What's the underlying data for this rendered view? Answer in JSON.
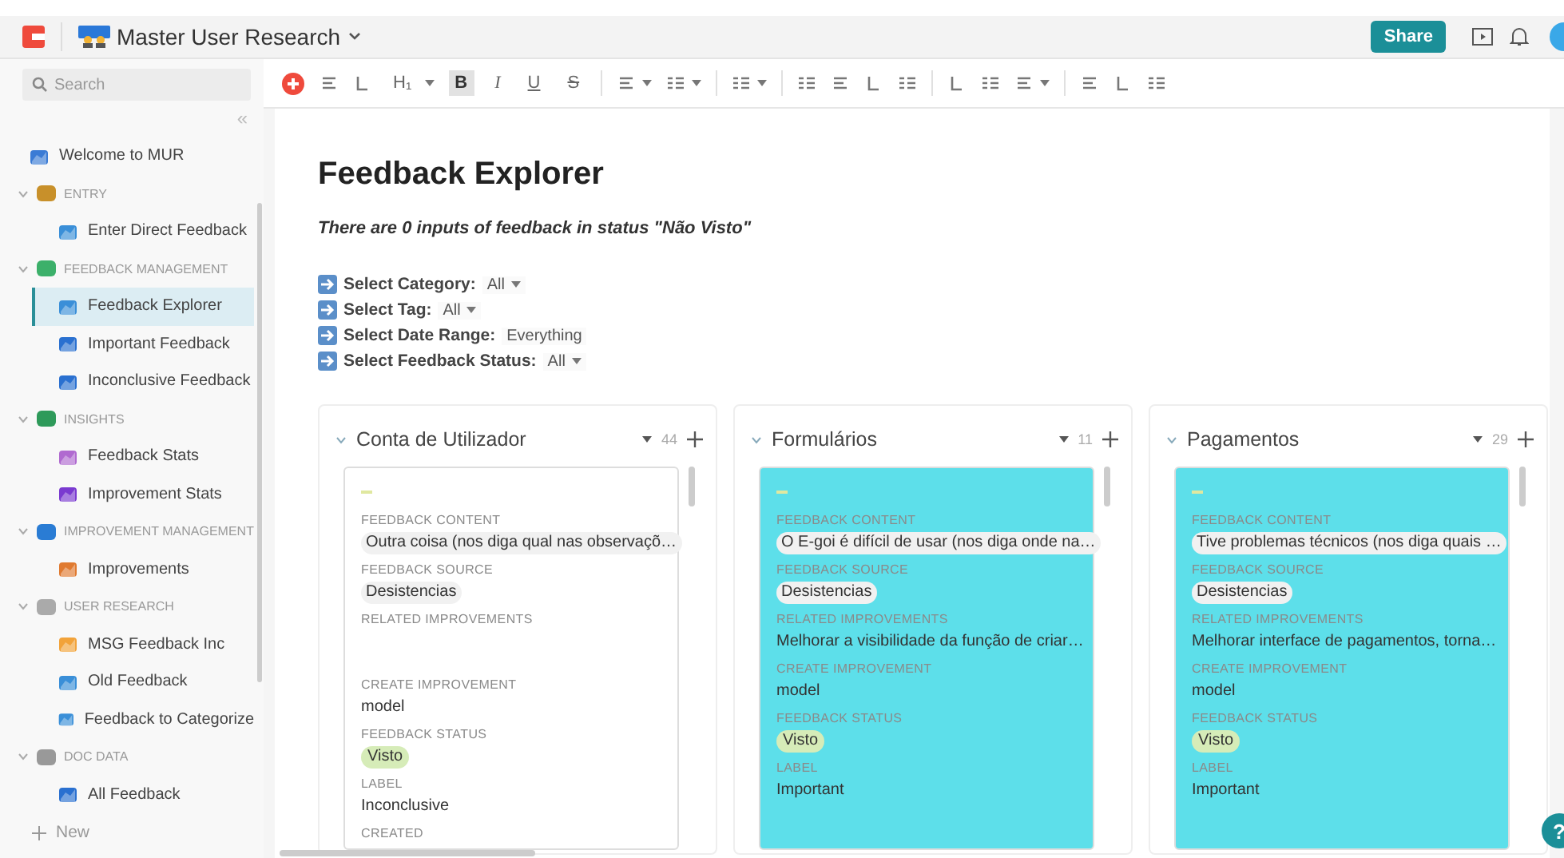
{
  "doc": {
    "title": "Master User Research",
    "share": "Share"
  },
  "search": {
    "placeholder": "Search"
  },
  "toolbar": [
    {
      "kind": "icon"
    },
    {
      "kind": "icon"
    },
    {
      "kind": "text",
      "label": "H₁",
      "selected": false
    },
    {
      "kind": "caret"
    },
    {
      "kind": "text",
      "label": "B",
      "selected": true
    },
    {
      "kind": "text",
      "label": "I",
      "selected": false
    },
    {
      "kind": "text",
      "label": "U",
      "selected": false
    },
    {
      "kind": "text",
      "label": "S",
      "selected": false
    },
    {
      "kind": "sep"
    },
    {
      "kind": "icon"
    },
    {
      "kind": "caret"
    },
    {
      "kind": "icon"
    },
    {
      "kind": "caret"
    },
    {
      "kind": "sep"
    },
    {
      "kind": "icon"
    },
    {
      "kind": "caret"
    },
    {
      "kind": "sep"
    },
    {
      "kind": "icon"
    },
    {
      "kind": "icon"
    },
    {
      "kind": "icon"
    },
    {
      "kind": "icon"
    },
    {
      "kind": "sep"
    },
    {
      "kind": "icon"
    },
    {
      "kind": "icon"
    },
    {
      "kind": "icon"
    },
    {
      "kind": "caret"
    },
    {
      "kind": "sep"
    },
    {
      "kind": "icon"
    },
    {
      "kind": "icon"
    },
    {
      "kind": "icon"
    }
  ],
  "sidebar": {
    "collapse": "«",
    "new": "New",
    "items": [
      {
        "kind": "page",
        "label": "Welcome to MUR",
        "selected": false
      },
      {
        "kind": "section",
        "label": "ENTRY",
        "expanded": true,
        "children": [
          {
            "kind": "page",
            "label": "Enter Direct Feedback",
            "selected": false
          }
        ]
      },
      {
        "kind": "section",
        "label": "FEEDBACK MANAGEMENT",
        "expanded": true,
        "children": [
          {
            "kind": "page",
            "label": "Feedback Explorer",
            "selected": true
          },
          {
            "kind": "page",
            "label": "Important Feedback",
            "selected": false
          },
          {
            "kind": "page",
            "label": "Inconclusive Feedback",
            "selected": false
          }
        ]
      },
      {
        "kind": "section",
        "label": "INSIGHTS",
        "expanded": true,
        "children": [
          {
            "kind": "page",
            "label": "Feedback Stats",
            "selected": false
          },
          {
            "kind": "page",
            "label": "Improvement Stats",
            "selected": false
          }
        ]
      },
      {
        "kind": "section",
        "label": "IMPROVEMENT MANAGEMENT",
        "expanded": true,
        "children": [
          {
            "kind": "page",
            "label": "Improvements",
            "selected": false
          }
        ]
      },
      {
        "kind": "section",
        "label": "USER RESEARCH",
        "expanded": true,
        "children": [
          {
            "kind": "page",
            "label": "MSG Feedback Inc",
            "selected": false
          },
          {
            "kind": "page",
            "label": "Old Feedback",
            "selected": false
          },
          {
            "kind": "page",
            "label": "Feedback to Categorize",
            "selected": false
          }
        ]
      },
      {
        "kind": "section",
        "label": "DOC DATA",
        "expanded": true,
        "children": [
          {
            "kind": "page",
            "label": "All Feedback",
            "selected": false
          }
        ]
      }
    ]
  },
  "page": {
    "title": "Feedback Explorer",
    "summary": "There are 0 inputs of feedback in status \"Não Visto\"",
    "filters": [
      {
        "label": "Select Category:",
        "value": "All",
        "dropdown": true
      },
      {
        "label": "Select Tag:",
        "value": "All",
        "dropdown": true
      },
      {
        "label": "Select Date Range:",
        "value": "Everything",
        "dropdown": false
      },
      {
        "label": "Select Feedback Status:",
        "value": "All",
        "dropdown": true
      }
    ]
  },
  "board": [
    {
      "name": "Conta de Utilizador",
      "count": "44",
      "card": {
        "color": "#ffffff",
        "fields": [
          {
            "label": "FEEDBACK CONTENT",
            "value": "Outra coisa (nos diga qual nas observaçõ…",
            "kind": "chip"
          },
          {
            "label": "FEEDBACK SOURCE",
            "value": "Desistencias",
            "kind": "chip"
          },
          {
            "label": "RELATED IMPROVEMENTS",
            "kind": "empty"
          },
          {
            "label": "CREATE IMPROVEMENT",
            "value": "model",
            "kind": "plain"
          },
          {
            "label": "FEEDBACK STATUS",
            "value": "Visto",
            "kind": "status"
          },
          {
            "label": "LABEL",
            "value": "Inconclusive",
            "kind": "plain"
          },
          {
            "label": "CREATED",
            "kind": "empty"
          }
        ]
      }
    },
    {
      "name": "Formulários",
      "count": "11",
      "card": {
        "color": "#5ddfea",
        "fields": [
          {
            "label": "FEEDBACK CONTENT",
            "value": "O E-goi é difícil de usar (nos diga onde na…",
            "kind": "chip"
          },
          {
            "label": "FEEDBACK SOURCE",
            "value": "Desistencias",
            "kind": "chip"
          },
          {
            "label": "RELATED IMPROVEMENTS",
            "value": "Melhorar a visibilidade da função de criar…",
            "kind": "plain"
          },
          {
            "label": "CREATE IMPROVEMENT",
            "value": "model",
            "kind": "plain"
          },
          {
            "label": "FEEDBACK STATUS",
            "value": "Visto",
            "kind": "status"
          },
          {
            "label": "LABEL",
            "value": "Important",
            "kind": "plain"
          }
        ]
      }
    },
    {
      "name": "Pagamentos",
      "count": "29",
      "card": {
        "color": "#5ddfea",
        "fields": [
          {
            "label": "FEEDBACK CONTENT",
            "value": "Tive problemas técnicos (nos diga quais …",
            "kind": "chip"
          },
          {
            "label": "FEEDBACK SOURCE",
            "value": "Desistencias",
            "kind": "chip"
          },
          {
            "label": "RELATED IMPROVEMENTS",
            "value": "Melhorar interface de pagamentos, torna…",
            "kind": "plain"
          },
          {
            "label": "CREATE IMPROVEMENT",
            "value": "model",
            "kind": "plain"
          },
          {
            "label": "FEEDBACK STATUS",
            "value": "Visto",
            "kind": "status"
          },
          {
            "label": "LABEL",
            "value": "Important",
            "kind": "plain"
          }
        ]
      }
    }
  ],
  "help": "?"
}
